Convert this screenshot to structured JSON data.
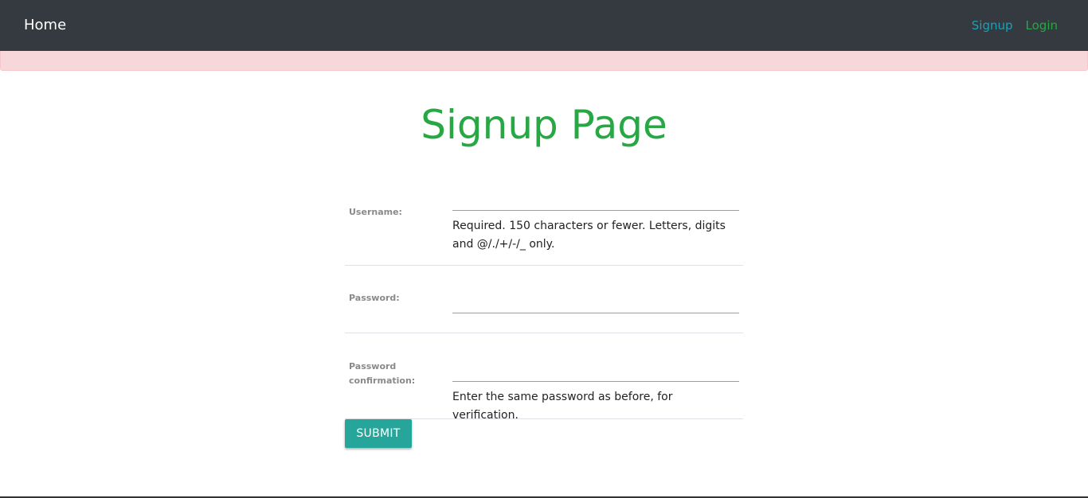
{
  "navbar": {
    "brand": "Home",
    "links": [
      {
        "label": "Signup",
        "color": "#17a2b8"
      },
      {
        "label": "Login",
        "color": "#28a745"
      }
    ]
  },
  "colors": {
    "navbar_bg": "#343a40",
    "alert_bg": "#f8d7da",
    "title": "#28a745",
    "submit_bg": "#26a69a"
  },
  "main": {
    "title": "Signup Page",
    "fields": [
      {
        "label": "Username:",
        "value": "",
        "help": "Required. 150 characters or fewer. Letters, digits and @/./+/-/_ only."
      },
      {
        "label": "Password:",
        "value": "",
        "help": ""
      },
      {
        "label": "Password confirmation:",
        "value": "",
        "help": "Enter the same password as before, for verification."
      }
    ],
    "submit_label": "SUBMIT"
  }
}
